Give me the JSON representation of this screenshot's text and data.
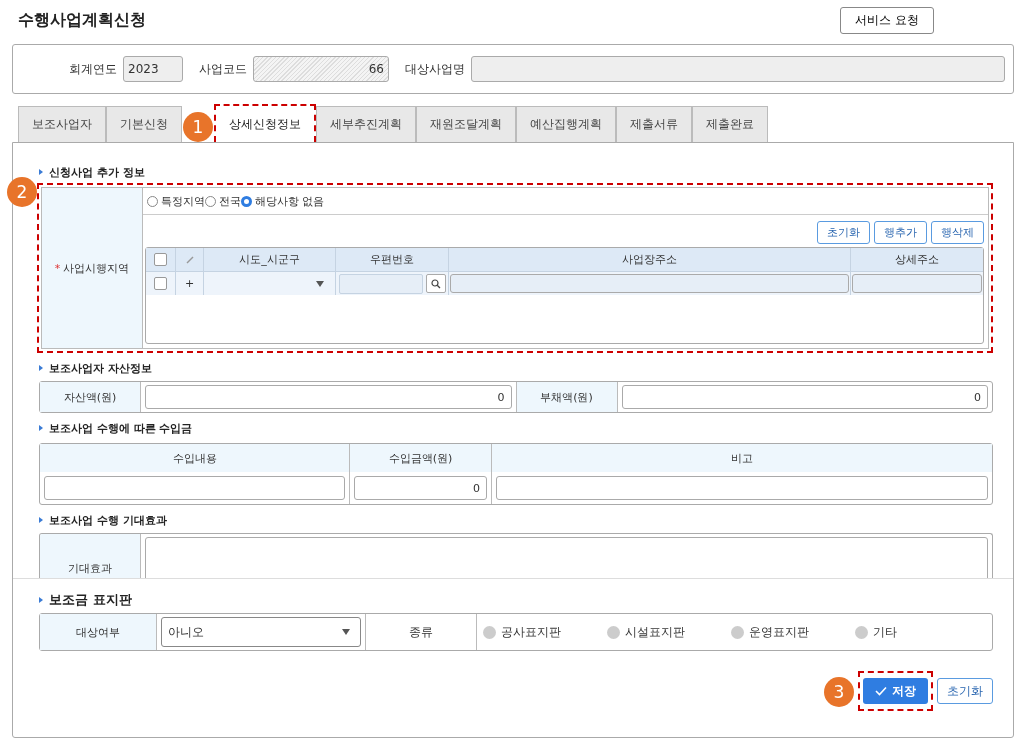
{
  "title": "수행사업계획신청",
  "service_button": "서비스 요청",
  "header": {
    "year": {
      "label": "회계연도",
      "value": "2023"
    },
    "code": {
      "label": "사업코드",
      "value": "66"
    },
    "target": {
      "label": "대상사업명"
    }
  },
  "tabs": [
    {
      "label": "보조사업자",
      "selected": false
    },
    {
      "label": "기본신청",
      "selected": false
    },
    {
      "label": "상세신청정보",
      "selected": true
    },
    {
      "label": "세부추진계획",
      "selected": false
    },
    {
      "label": "재원조달계획",
      "selected": false
    },
    {
      "label": "예산집행계획",
      "selected": false
    },
    {
      "label": "제출서류",
      "selected": false
    },
    {
      "label": "제출완료",
      "selected": false
    }
  ],
  "callouts": [
    "1",
    "2",
    "3"
  ],
  "region": {
    "heading": "신청사업 추가 정보",
    "label": "사업시행지역",
    "required_mark": "*",
    "select_all": {
      "checked": false
    },
    "rows": [
      {
        "checked": false
      }
    ],
    "options": [
      {
        "label": "특정지역",
        "selected": false
      },
      {
        "label": "전국",
        "selected": false
      },
      {
        "label": "해당사항 없음",
        "selected": true
      }
    ],
    "buttons": [
      "초기화",
      "행추가",
      "행삭제"
    ],
    "columns": [
      "시도_시군구",
      "우편번호",
      "사업장주소",
      "상세주소"
    ],
    "new_row_mark": "+"
  },
  "assets": {
    "heading": "보조사업자 자산정보",
    "fields": [
      {
        "label": "자산액(원)",
        "value": "0"
      },
      {
        "label": "부채액(원)",
        "value": "0"
      }
    ]
  },
  "income": {
    "heading": "보조사업 수행에 따른 수입금",
    "columns": [
      "수입내용",
      "수입금액(원)",
      "비고"
    ],
    "amount_value": "0"
  },
  "effect": {
    "heading": "보조사업 수행 기대효과",
    "label": "기대효과"
  },
  "signboard": {
    "heading": "보조금 표지판",
    "target_label": "대상여부",
    "target_value": "아니오",
    "type_label": "종류",
    "types": [
      {
        "label": "공사표지판",
        "selected": false
      },
      {
        "label": "시설표지판",
        "selected": false
      },
      {
        "label": "운영표지판",
        "selected": false
      },
      {
        "label": "기타",
        "selected": false
      }
    ]
  },
  "actions": [
    {
      "label": "저장",
      "kind": "primary"
    },
    {
      "label": "초기화",
      "kind": "secondary"
    }
  ]
}
